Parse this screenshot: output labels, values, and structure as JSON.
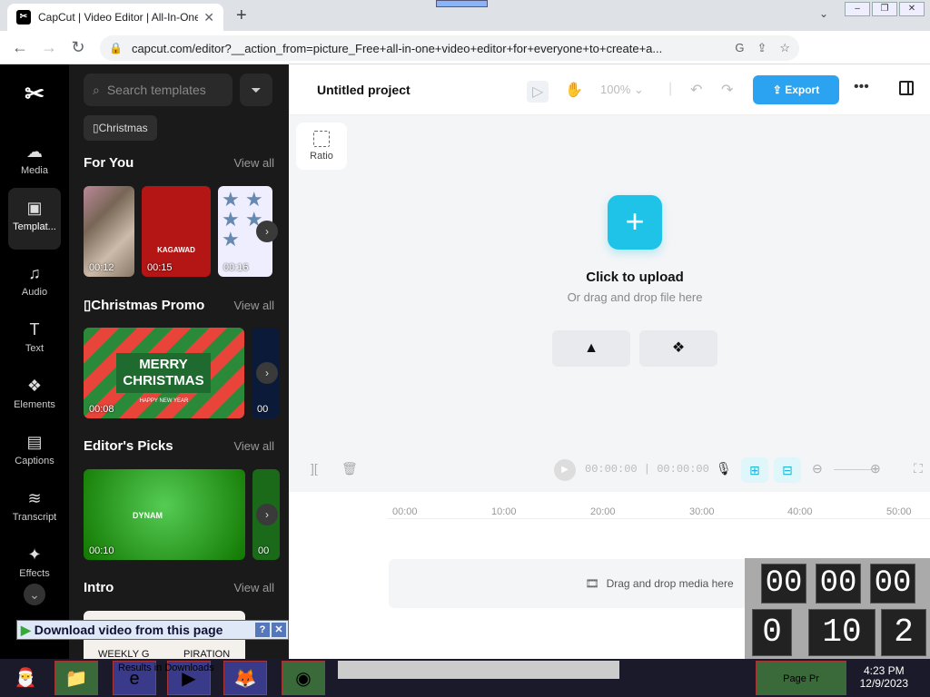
{
  "browser": {
    "tab_title": "CapCut | Video Editor | All-In-One",
    "url": "capcut.com/editor?__action_from=picture_Free+all-in-one+video+editor+for+everyone+to+create+a..."
  },
  "sidebar": {
    "items": [
      {
        "label": "Media",
        "icon": "cloud-upload-icon"
      },
      {
        "label": "Templat...",
        "icon": "template-icon"
      },
      {
        "label": "Audio",
        "icon": "music-icon"
      },
      {
        "label": "Text",
        "icon": "text-icon"
      },
      {
        "label": "Elements",
        "icon": "elements-icon"
      },
      {
        "label": "Captions",
        "icon": "captions-icon"
      },
      {
        "label": "Transcript",
        "icon": "transcript-icon"
      },
      {
        "label": "Effects",
        "icon": "effects-icon"
      }
    ]
  },
  "panel": {
    "search_placeholder": "Search templates",
    "chip": "Christmas",
    "view_all": "View all",
    "sections": [
      {
        "title": "For You",
        "durations": [
          "00:12",
          "00:15",
          "00:16"
        ]
      },
      {
        "title": "Christmas Promo",
        "durations": [
          "00:08",
          "00"
        ]
      },
      {
        "title": "Editor's Picks",
        "durations": [
          "00:10",
          "00"
        ]
      },
      {
        "title": "Intro"
      }
    ],
    "thumb_texts": {
      "kagawad": "KAGAWAD",
      "merry": "MERRY",
      "christmas": "CHRISTMAS",
      "happy_new_year": "HAPPY NEW YEAR",
      "dynam": "DYNAM",
      "weekly": "WEEKLY G",
      "inspiration": "PIRATION"
    }
  },
  "topbar": {
    "project_title": "Untitled project",
    "zoom": "100%",
    "export_label": "Export"
  },
  "canvas": {
    "ratio_label": "Ratio",
    "upload_title": "Click to upload",
    "upload_sub": "Or drag and drop file here"
  },
  "timeline": {
    "timecode": "00:00:00 | 00:00:00",
    "ticks": [
      "00:00",
      "10:00",
      "20:00",
      "30:00",
      "40:00",
      "50:00"
    ],
    "drop_text": "Drag and drop media here"
  },
  "overlay": {
    "download_label": "Download video from this page",
    "taskbar_text": "Results in Downloads",
    "time": "4:23 PM",
    "date": "12/9/2023",
    "tray_label": "Page Pr",
    "clock_top": [
      "00",
      "00",
      "00"
    ],
    "clock_bottom": [
      "0",
      "10",
      "2"
    ]
  },
  "colors": {
    "accent": "#2ba3f0",
    "upload": "#1fc3e8",
    "nav_bg": "#000000",
    "panel_bg": "#1a1a1a"
  }
}
